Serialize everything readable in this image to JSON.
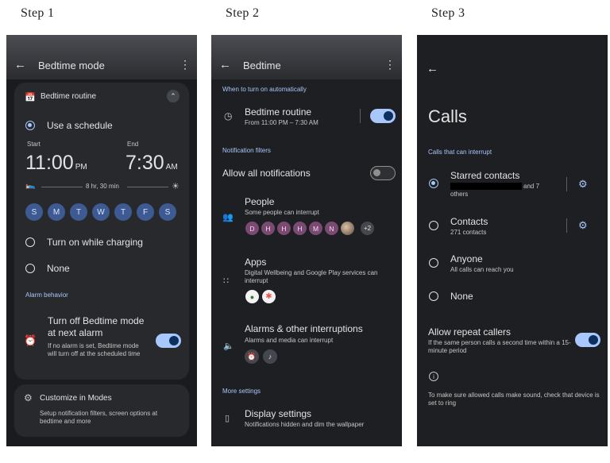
{
  "steps": [
    "Step 1",
    "Step 2",
    "Step 3"
  ],
  "colors": {
    "accent": "#a8c7fa",
    "background": "#1e1f22",
    "card": "#28292d",
    "day_chip": "#3d5a93",
    "avatar": "#7b4a72"
  },
  "step1": {
    "title": "Bedtime mode",
    "routine_header": "Bedtime routine",
    "use_schedule": "Use a schedule",
    "start_label": "Start",
    "end_label": "End",
    "start_time": "11:00",
    "start_ampm": "PM",
    "end_time": "7:30",
    "end_ampm": "AM",
    "duration": "8 hr, 30 min",
    "days": [
      "S",
      "M",
      "T",
      "W",
      "T",
      "F",
      "S"
    ],
    "charging": "Turn on while charging",
    "none": "None",
    "alarm_behavior": "Alarm behavior",
    "alarm_title": "Turn off Bedtime mode at next alarm",
    "alarm_desc": "If no alarm is set, Bedtime mode will turn off at the scheduled time",
    "customize_title": "Customize in Modes",
    "customize_desc": "Setup notification filters, screen options at bedtime and more"
  },
  "step2": {
    "title": "Bedtime",
    "section_auto": "When to turn on automatically",
    "routine_title": "Bedtime routine",
    "routine_sub": "From 11:00 PM – 7:30 AM",
    "section_filters": "Notification filters",
    "allow_all": "Allow all notifications",
    "people_title": "People",
    "people_sub": "Some people can interrupt",
    "people_avatars": [
      "D",
      "H",
      "H",
      "H",
      "M",
      "N"
    ],
    "people_more": "+2",
    "apps_title": "Apps",
    "apps_sub": "Digital Wellbeing and Google Play services can interrupt",
    "alarms_title": "Alarms & other interruptions",
    "alarms_sub": "Alarms and media can interrupt",
    "section_more": "More settings",
    "display_title": "Display settings",
    "display_sub": "Notifications hidden and dim the wallpaper"
  },
  "step3": {
    "title": "Calls",
    "section": "Calls that can interrupt",
    "starred_title": "Starred contacts",
    "starred_sub_tail": "and 7",
    "starred_sub_2": "others",
    "contacts_title": "Contacts",
    "contacts_sub": "271 contacts",
    "anyone_title": "Anyone",
    "anyone_sub": "All calls can reach you",
    "none_title": "None",
    "repeat_title": "Allow repeat callers",
    "repeat_sub": "If the same person calls a second time within a 15-minute period",
    "info_text": "To make sure allowed calls make sound, check that device is set to ring"
  }
}
